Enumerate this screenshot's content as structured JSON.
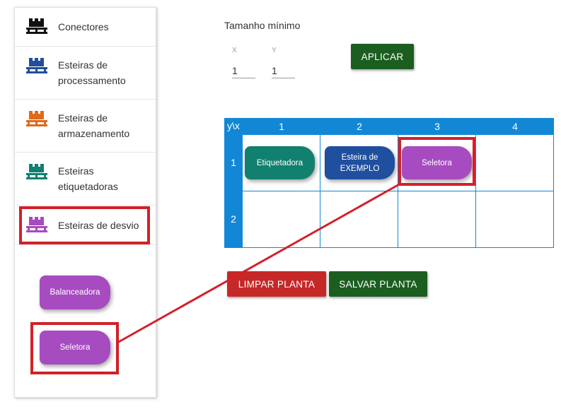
{
  "sidebar": {
    "items": [
      {
        "label": "Conectores",
        "icon": "pallet-icon",
        "color": "#111111"
      },
      {
        "label": "Esteiras de processamento",
        "icon": "pallet-icon",
        "color": "#1f4f9e"
      },
      {
        "label": "Esteiras de armazenamento",
        "icon": "pallet-icon",
        "color": "#e06a1b"
      },
      {
        "label": "Esteiras etiquetadoras",
        "icon": "pallet-icon",
        "color": "#11806e"
      },
      {
        "label": "Esteiras de desvio",
        "icon": "pallet-icon",
        "color": "#a74bc0"
      }
    ],
    "chips": [
      {
        "label": "Balanceadora",
        "color": "#a74bc0"
      },
      {
        "label": "Seletora",
        "color": "#a74bc0"
      }
    ]
  },
  "min_size": {
    "title": "Tamanho mínimo",
    "x_label": "X",
    "x_value": "1",
    "y_label": "Y",
    "y_value": "1",
    "apply_label": "APLICAR"
  },
  "grid": {
    "corner": "y\\x",
    "columns": [
      "1",
      "2",
      "3",
      "4"
    ],
    "rows": [
      "1",
      "2"
    ],
    "placed": [
      {
        "label": "Etiquetadora",
        "color": "#11806e"
      },
      {
        "label": "Esteira de EXEMPLO",
        "color": "#1f4f9e"
      },
      {
        "label": "Seletora",
        "color": "#a74bc0"
      }
    ]
  },
  "actions": {
    "clear_label": "LIMPAR PLANTA",
    "save_label": "SALVAR PLANTA"
  },
  "colors": {
    "grid_blue": "#1287d6",
    "apply_green": "#1b5e20",
    "clear_red": "#c62828",
    "annotation_red": "#d32029"
  }
}
